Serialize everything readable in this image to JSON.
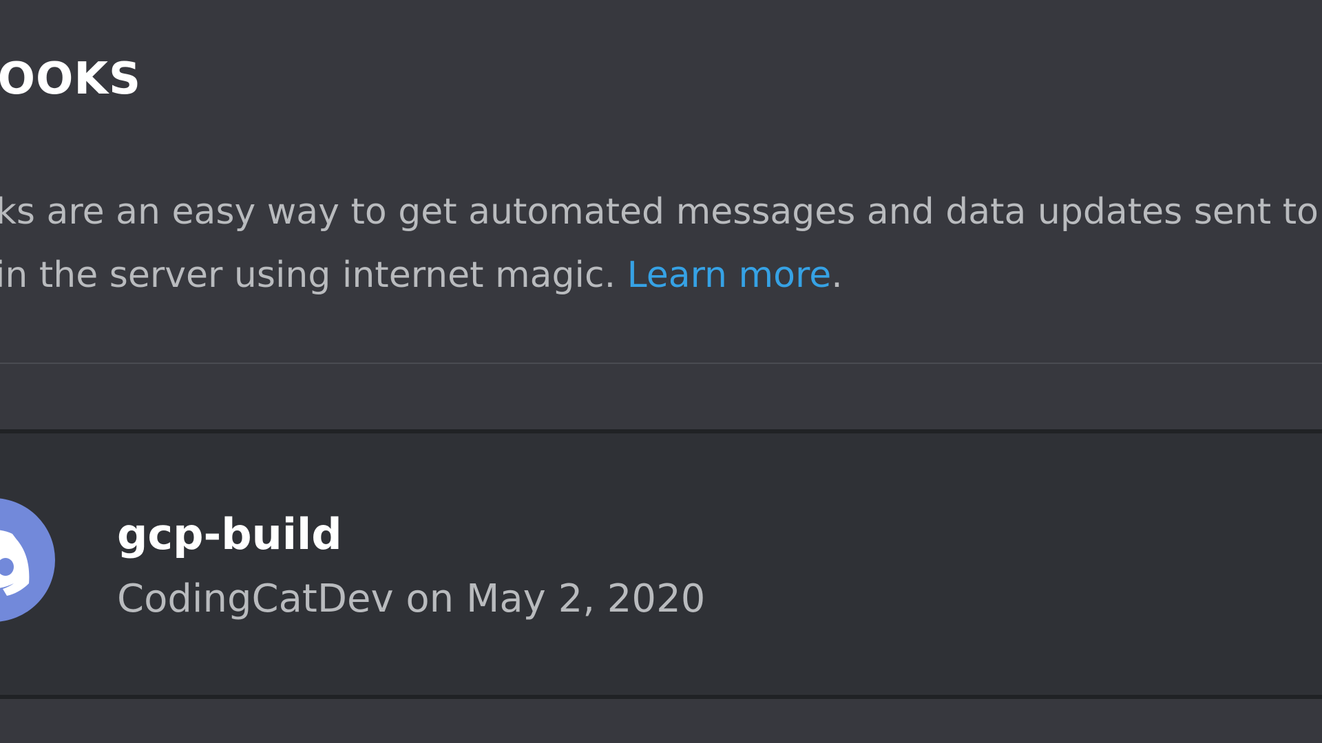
{
  "header": {
    "title": "HOOKS"
  },
  "description": {
    "line1": "oks are an easy way to get automated messages and data updates sent to",
    "line2_prefix": "l in the server using internet magic. ",
    "link_label": "Learn more",
    "line2_suffix": "."
  },
  "webhooks": [
    {
      "name": "gcp-build",
      "created_by": "CodingCatDev",
      "on_word": "on",
      "created_date": "May 2, 2020",
      "avatar_icon": "discord-logo-icon"
    }
  ],
  "colors": {
    "background": "#36393f",
    "card": "#2f3136",
    "link": "#36a2e5",
    "avatar": "#7289da"
  }
}
